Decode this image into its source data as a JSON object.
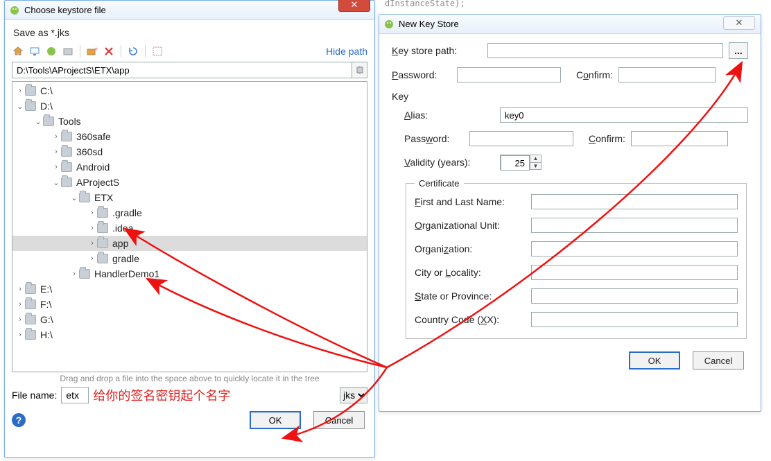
{
  "peek_code": "dInstanceState);",
  "left": {
    "title": "Choose keystore file",
    "save_as": "Save as *.jks",
    "hide_path": "Hide path",
    "path_value": "D:\\Tools\\AProjectS\\ETX\\app",
    "tree": {
      "C": "C:\\",
      "D": "D:\\",
      "Tools": "Tools",
      "safe": "360safe",
      "sd": "360sd",
      "Android": "Android",
      "AProjectS": "AProjectS",
      "ETX": "ETX",
      "gradle_hidden": ".gradle",
      "idea": ".idea",
      "app": "app",
      "gradle": "gradle",
      "HandlerDemo1": "HandlerDemo1",
      "E": "E:\\",
      "F": "F:\\",
      "G": "G:\\",
      "H": "H:\\"
    },
    "drag_hint": "Drag and drop a file into the space above to quickly locate it in the tree",
    "file_name_label": "File name:",
    "file_name_value": "etx",
    "annotation": "给你的签名密钥起个名字",
    "ext": "jks",
    "ok": "OK",
    "cancel": "Cancel"
  },
  "right": {
    "title": "New Key Store",
    "ksp_label": "Key store path:",
    "ksp_value": "",
    "pw_label": "Password:",
    "confirm_label": "Confirm:",
    "key_label": "Key",
    "alias_label": "Alias:",
    "alias_value": "key0",
    "validity_label": "Validity (years):",
    "validity_value": "25",
    "cert_legend": "Certificate",
    "first_last": "First and Last Name:",
    "org_unit": "Organizational Unit:",
    "org": "Organization:",
    "city": "City or Locality:",
    "state": "State or Province:",
    "cc": "Country Code (XX):",
    "ok": "OK",
    "cancel": "Cancel"
  }
}
